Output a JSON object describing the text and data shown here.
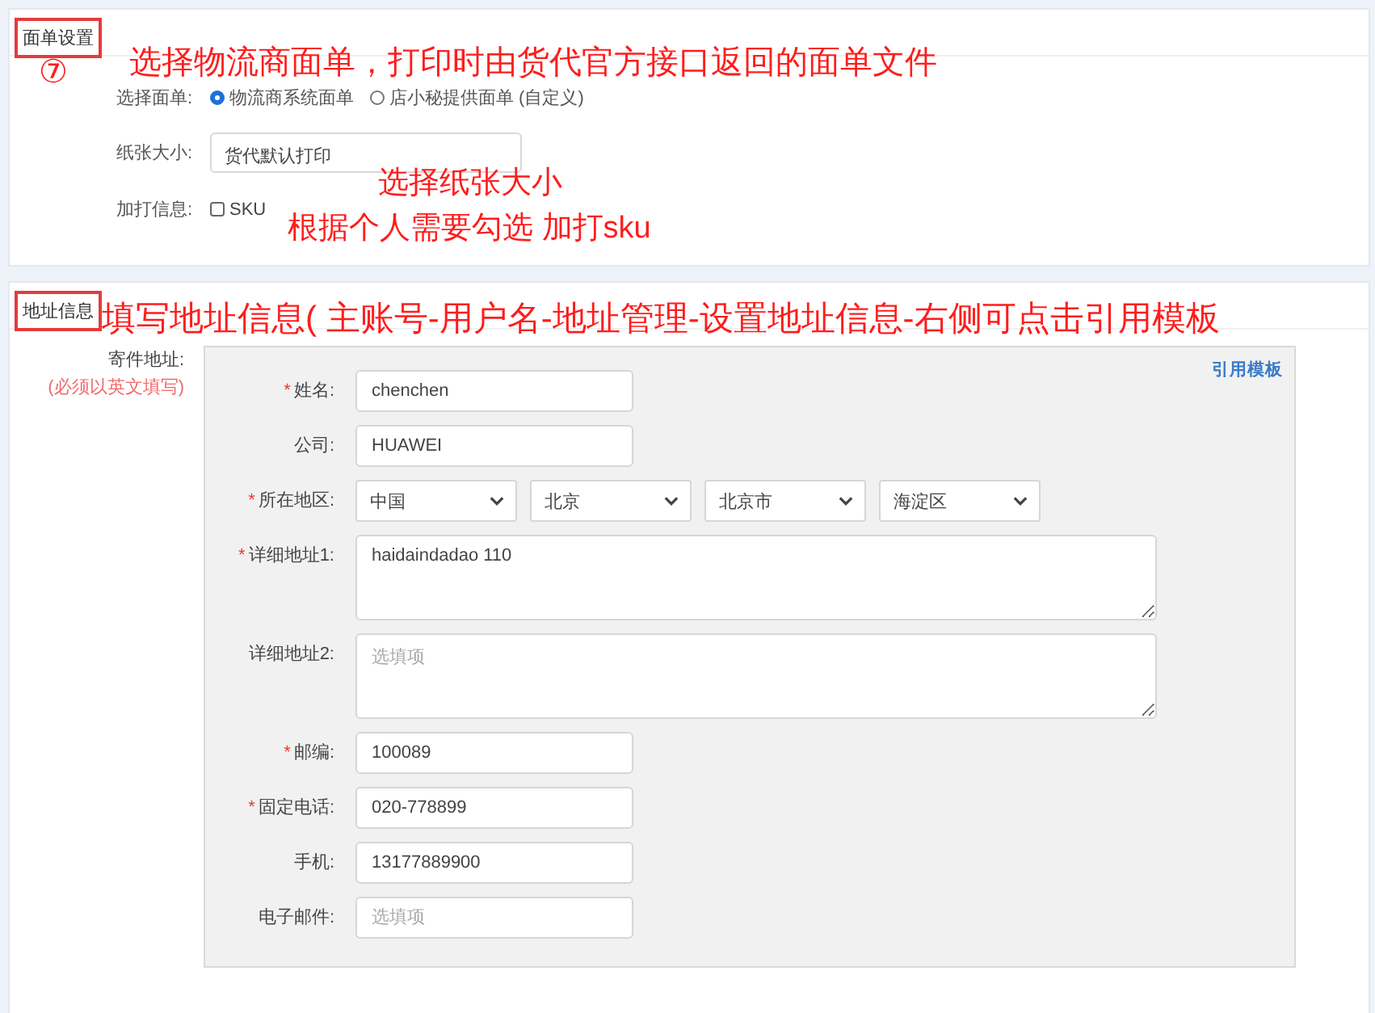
{
  "waybill_section": {
    "title": "面单设置",
    "title_marked": true,
    "template": {
      "label": "选择面单:",
      "options": [
        {
          "label": "物流商系统面单",
          "selected": true
        },
        {
          "label": "店小秘提供面单 (自定义)",
          "selected": false
        }
      ]
    },
    "paper_size": {
      "label": "纸张大小:",
      "value": "货代默认打印"
    },
    "extra_print": {
      "label": "加打信息:",
      "options": [
        {
          "label": "SKU",
          "checked": false
        }
      ]
    }
  },
  "address_section": {
    "title": "地址信息",
    "title_marked": true,
    "sender_label": "寄件地址:",
    "sender_note": "(必须以英文填写)",
    "template_link": "引用模板",
    "fields": [
      {
        "kind": "input",
        "required_mark": "*",
        "label": "姓名:",
        "value": "chenchen"
      },
      {
        "kind": "input",
        "label": "公司:",
        "value": "HUAWEI"
      },
      {
        "kind": "selects",
        "required_mark": "*",
        "label": "所在地区:",
        "values": [
          "中国",
          "北京",
          "北京市",
          "海淀区"
        ]
      },
      {
        "kind": "textarea",
        "required_mark": "*",
        "label": "详细地址1:",
        "value": "haidaindadao 110"
      },
      {
        "kind": "textarea",
        "label": "详细地址2:",
        "placeholder": "选填项"
      },
      {
        "kind": "input",
        "required_mark": "*",
        "label": "邮编:",
        "value": "100089"
      },
      {
        "kind": "input",
        "required_mark": "*",
        "label": "固定电话:",
        "value": "020-778899"
      },
      {
        "kind": "input",
        "label": "手机:",
        "value": "13177889900"
      },
      {
        "kind": "input",
        "label": "电子邮件:",
        "placeholder": "选填项"
      }
    ]
  },
  "step_number": "⑦",
  "annotations": [
    "选择物流商面单，打印时由货代官方接口返回的面单文件",
    "选择纸张大小",
    "根据个人需要勾选 加打sku",
    "填写地址信息( 主账号-用户名-地址管理-设置地址信息-右侧可点击引用模板"
  ]
}
